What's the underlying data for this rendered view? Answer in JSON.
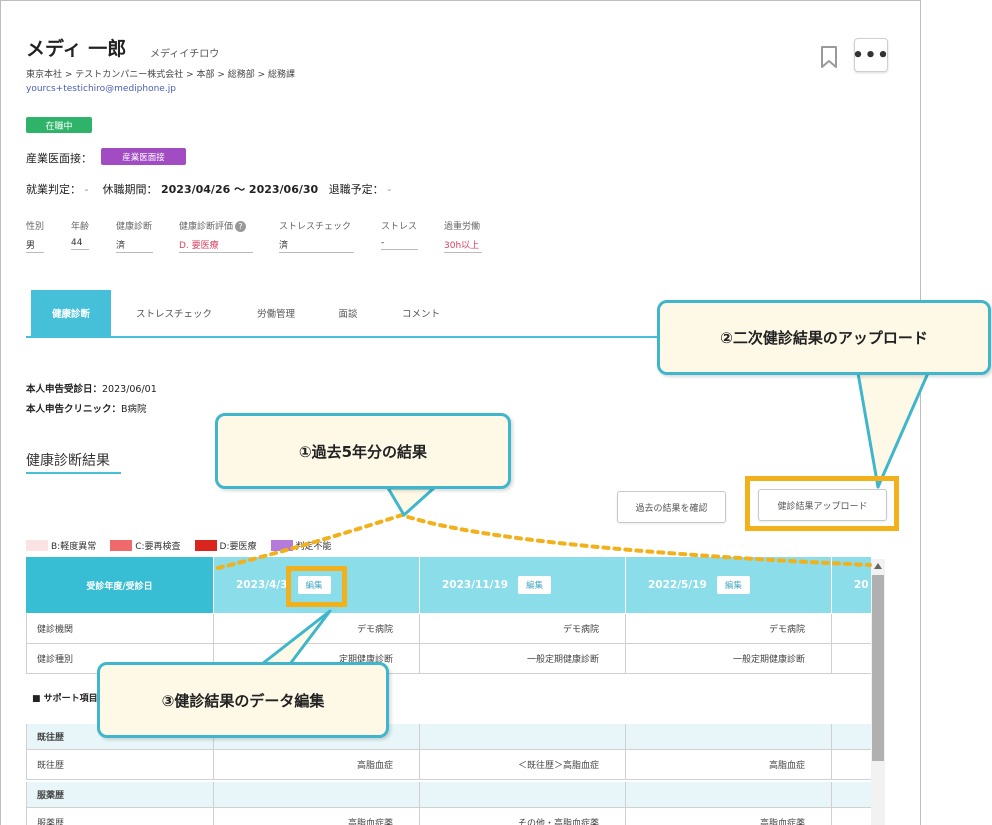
{
  "employee": {
    "name": "メディ 一郎",
    "kana": "メディイチロウ",
    "breadcrumb": "東京本社 > テストカンパニー株式会社 > 本部 > 総務部 > 総務課",
    "email": "yourcs+testichiro@mediphone.jp",
    "status": "在職中",
    "sangyo_label": "産業医面接：",
    "sangyo_badge": "産業医面接"
  },
  "work": {
    "judgement_label": "就業判定：",
    "judgement_value": "-",
    "leave_label": "休職期間：",
    "leave_value": "2023/04/26 ～ 2023/06/30",
    "retire_label": "退職予定：",
    "retire_value": "-"
  },
  "metrics": [
    {
      "label": "性別",
      "value": "男"
    },
    {
      "label": "年齢",
      "value": "44"
    },
    {
      "label": "健康診断",
      "value": "済"
    },
    {
      "label": "健康診断評価",
      "value": "D. 要医療"
    },
    {
      "label": "ストレスチェック",
      "value": "済"
    },
    {
      "label": "ストレス",
      "value": "-"
    },
    {
      "label": "過重労働",
      "value": "30h以上"
    }
  ],
  "tabs": [
    "健康診断",
    "ストレスチェック",
    "労働管理",
    "面談",
    "コメント"
  ],
  "self_report": {
    "date_label": "本人申告受診日：",
    "date_value": "2023/06/01",
    "clinic_label": "本人申告クリニック：",
    "clinic_value": "B病院"
  },
  "section_title": "健康診断結果",
  "buttons": {
    "past_results": "過去の結果を確認",
    "upload": "健診結果アップロード",
    "edit": "編集"
  },
  "legend": [
    {
      "label": "B:軽度異常",
      "color": "#fbe3e3"
    },
    {
      "label": "C:要再検査",
      "color": "#ef6b6b"
    },
    {
      "label": "D:要医療",
      "color": "#d9251d"
    },
    {
      "label": "判定不能",
      "color": "#b57bd8"
    }
  ],
  "table": {
    "header_label": "受診年度/受診日",
    "dates": [
      "2023/4/3",
      "2023/11/19",
      "2022/5/19",
      "20"
    ],
    "rows": [
      {
        "label": "健診機関",
        "values": [
          "デモ病院",
          "デモ病院",
          "デモ病院",
          ""
        ]
      },
      {
        "label": "健診種別",
        "values": [
          "定期健康診断",
          "一般定期健康診断",
          "一般定期健康診断",
          ""
        ]
      }
    ],
    "support_label": "■ サポート項目",
    "groups": [
      {
        "title": "既往歴",
        "row_label": "既往歴",
        "values": [
          "高脂血症",
          "＜既往歴＞高脂血症",
          "高脂血症",
          ""
        ]
      },
      {
        "title": "服薬歴",
        "row_label": "服薬歴",
        "values": [
          "高脂血症薬",
          "その他・高脂血症薬",
          "高脂血症薬",
          ""
        ]
      }
    ]
  },
  "callouts": {
    "one": "①過去5年分の結果",
    "two": "②二次健診結果のアップロード",
    "three": "③健診結果のデータ編集"
  },
  "colors": {
    "accent": "#46c0d9",
    "highlight": "#f2b11b",
    "callout_bg": "#fef9e6",
    "status_green": "#2fb36b",
    "badge_purple": "#a24cc4"
  }
}
